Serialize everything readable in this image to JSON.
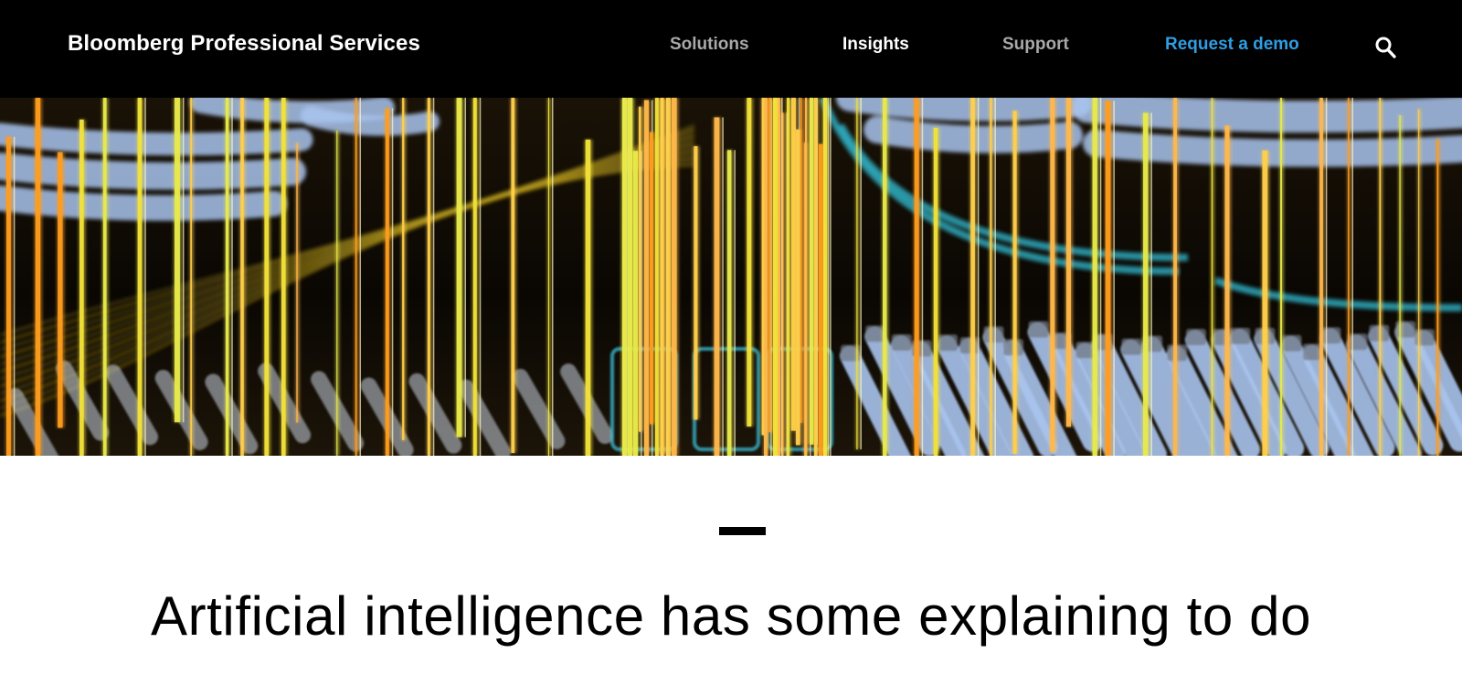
{
  "header": {
    "brand": "Bloomberg Professional Services",
    "nav": [
      {
        "label": "Solutions"
      },
      {
        "label": "Insights"
      },
      {
        "label": "Support"
      },
      {
        "label": "Request a demo"
      }
    ],
    "search_icon": "search-icon"
  },
  "hero": {
    "image": "fiber-optic-cables-long-exposure"
  },
  "article": {
    "title": "Artificial intelligence has some explaining to do"
  },
  "colors": {
    "header_bg": "#000000",
    "nav_muted": "#a8a8a8",
    "nav_active": "#ffffff",
    "cta": "#2f9ee3",
    "accent_orange": "#ff9d1e",
    "accent_yellow": "#f2e23a",
    "cable_blue": "#a9c4ee"
  }
}
